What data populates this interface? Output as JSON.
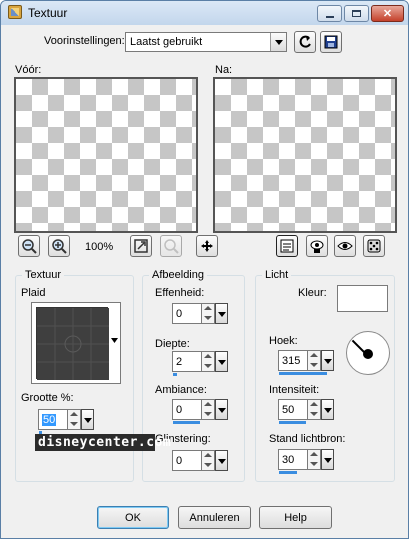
{
  "window": {
    "title": "Textuur"
  },
  "presets": {
    "label": "Voorinstellingen:",
    "value": "Laatst gebruikt"
  },
  "preview": {
    "before_label": "Vóór:",
    "after_label": "Na:",
    "zoom": "100%"
  },
  "texture": {
    "group_title": "Textuur",
    "pattern_name": "Plaid",
    "size_label": "Grootte %:",
    "size_value": "50",
    "size_fraction": 0.05
  },
  "image": {
    "group_title": "Afbeelding",
    "smoothness_label": "Effenheid:",
    "smoothness_value": "0",
    "depth_label": "Diepte:",
    "depth_value": "2",
    "depth_fraction": 0.08,
    "ambience_label": "Ambiance:",
    "ambience_value": "0",
    "ambience_fraction": 0.5,
    "shine_label": "Glinstering:",
    "shine_value": "0"
  },
  "light": {
    "group_title": "Licht",
    "color_label": "Kleur:",
    "color_value": "#ffffff",
    "angle_label": "Hoek:",
    "angle_value": "315",
    "angle_fraction": 0.88,
    "intensity_label": "Intensiteit:",
    "intensity_value": "50",
    "intensity_fraction": 0.5,
    "elevation_label": "Stand lichtbron:",
    "elevation_value": "30",
    "elevation_fraction": 0.33
  },
  "watermark": "disneycenter.com",
  "buttons": {
    "ok": "OK",
    "cancel": "Annuleren",
    "help": "Help"
  },
  "colors": {
    "accent": "#3a8de0",
    "swatch": "#3f3f3f",
    "checker": "#c6c6c6"
  }
}
